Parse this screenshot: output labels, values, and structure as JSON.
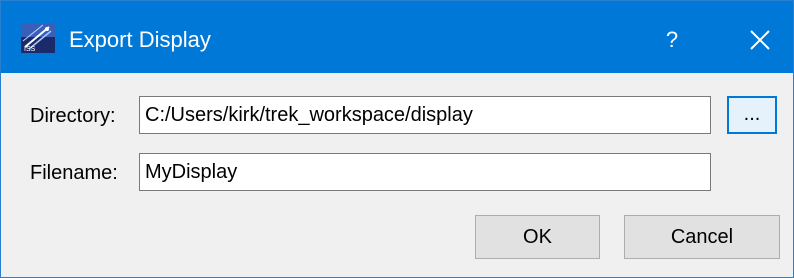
{
  "dialog": {
    "title": "Export Display",
    "help_label": "?",
    "title_bar_color": "#0078d7"
  },
  "form": {
    "directory_label": "Directory:",
    "directory_value": "C:/Users/kirk/trek_workspace/display",
    "browse_label": "...",
    "filename_label": "Filename:",
    "filename_value": "MyDisplay"
  },
  "buttons": {
    "ok_label": "OK",
    "cancel_label": "Cancel"
  },
  "icons": {
    "app": "trek-app-icon",
    "close": "close-icon"
  }
}
